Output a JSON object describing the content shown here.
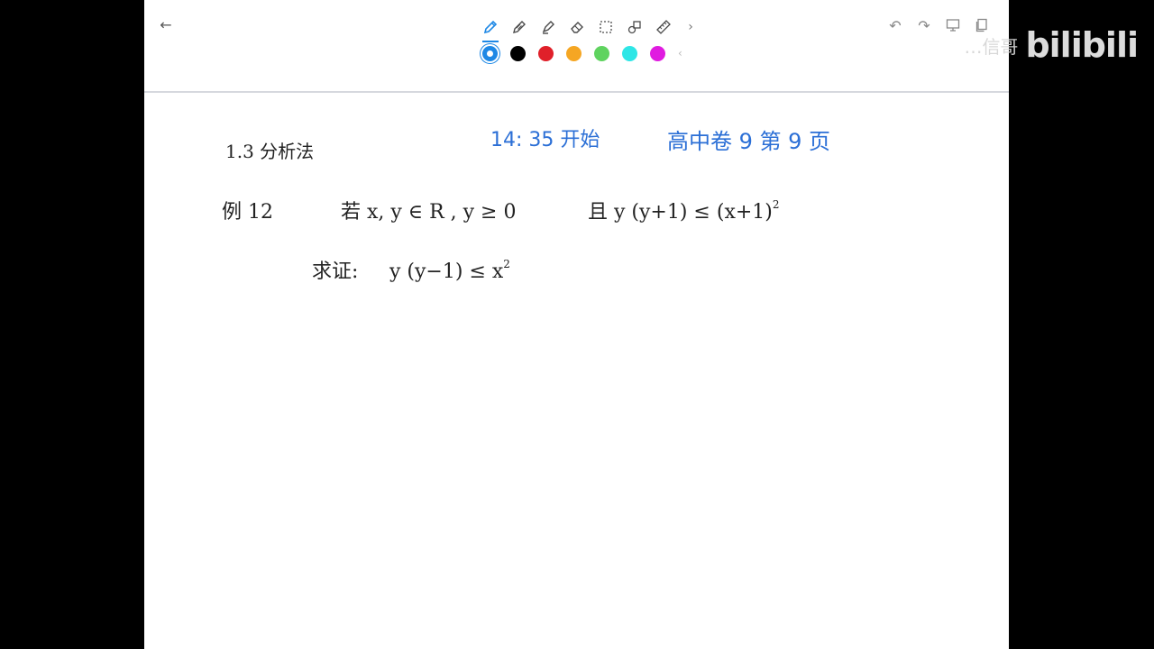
{
  "toolbar": {
    "tools": [
      {
        "name": "pen-tool-icon",
        "active": true
      },
      {
        "name": "pencil-tool-icon",
        "active": false
      },
      {
        "name": "highlighter-tool-icon",
        "active": false
      },
      {
        "name": "eraser-tool-icon",
        "active": false
      },
      {
        "name": "lasso-select-icon",
        "active": false
      },
      {
        "name": "shapes-tool-icon",
        "active": false
      },
      {
        "name": "ruler-tool-icon",
        "active": false
      }
    ],
    "more_tools": "›",
    "colors": [
      "#1e88e5",
      "#000000",
      "#e0202a",
      "#f5a623",
      "#5fd35f",
      "#2ee6e6",
      "#e01be0"
    ],
    "more_colors": "‹",
    "back": "←",
    "undo": "↶",
    "redo": "↷"
  },
  "watermark": {
    "name": "…信哥",
    "brand": "bilibili"
  },
  "notes": {
    "section": "1.3  分析法",
    "start_time": "14: 35 开始",
    "source": "高中卷 9  第 9 页",
    "example_label": "例 12",
    "example_condition_1": "若 x, y ∈ R ,  y ≥ 0",
    "example_condition_2": "且 y (y+1) ≤ (x+1)",
    "example_condition_2_sup": "2",
    "prove_label": "求证:",
    "prove_expr": "y (y−1) ≤ x",
    "prove_expr_sup": "2"
  }
}
